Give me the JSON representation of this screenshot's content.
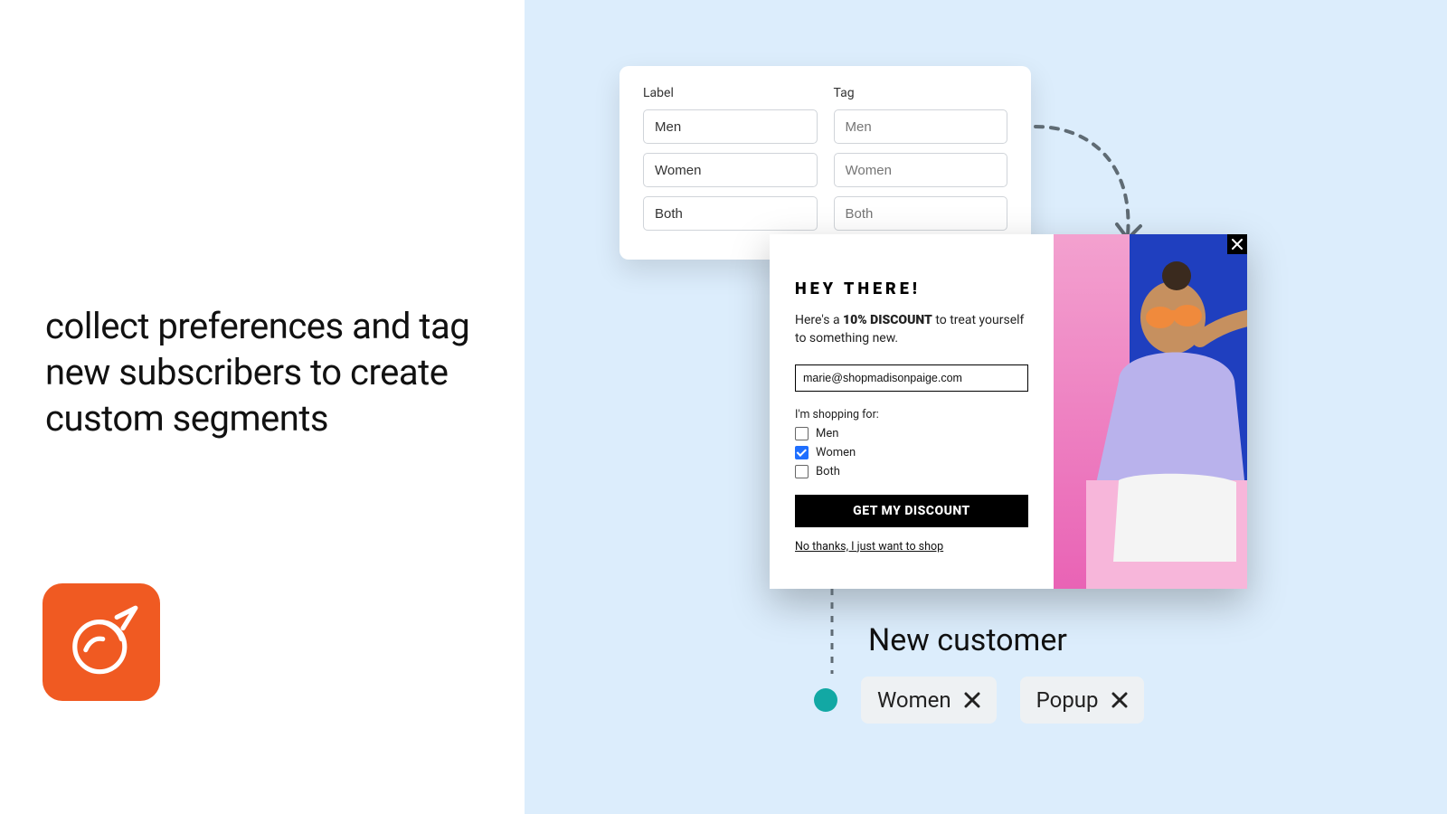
{
  "headline": "collect preferences and tag new subscribers to create custom segments",
  "settings": {
    "labelHeader": "Label",
    "tagHeader": "Tag",
    "rows": [
      {
        "label": "Men",
        "tag": "Men"
      },
      {
        "label": "Women",
        "tag": "Women"
      },
      {
        "label": "Both",
        "tag": "Both"
      }
    ]
  },
  "popup": {
    "title": "HEY THERE!",
    "copyPrefix": "Here's a ",
    "copyBold": "10% DISCOUNT",
    "copySuffix": " to treat yourself to something new.",
    "email": "marie@shopmadisonpaige.com",
    "prompt": "I'm shopping for:",
    "options": [
      {
        "label": "Men",
        "checked": false
      },
      {
        "label": "Women",
        "checked": true
      },
      {
        "label": "Both",
        "checked": false
      }
    ],
    "cta": "GET MY DISCOUNT",
    "decline": "No thanks, I just want to shop"
  },
  "segment": {
    "title": "New customer",
    "chips": [
      {
        "label": "Women"
      },
      {
        "label": "Popup"
      }
    ]
  },
  "colors": {
    "brand": "#f05a22",
    "canvas": "#dcedfc",
    "accent": "#1f6fff",
    "dot": "#12a8a4"
  }
}
